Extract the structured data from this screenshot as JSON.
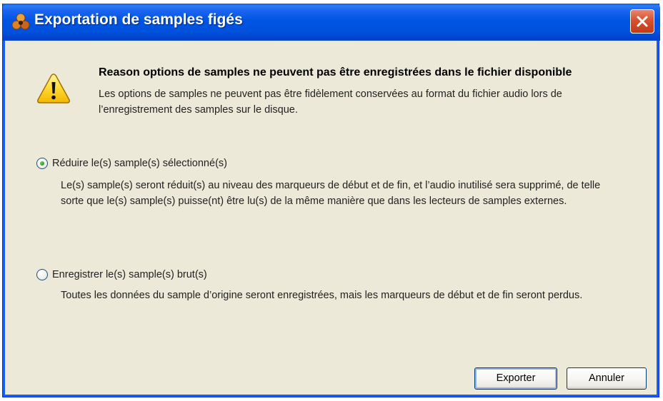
{
  "window": {
    "title": "Exportation de samples figés",
    "icons": {
      "app": "reason-app-icon",
      "close": "close-icon",
      "warning": "warning-icon"
    }
  },
  "message": {
    "headline": "Reason options de samples ne peuvent pas être enregistrées dans le fichier disponible",
    "description": "Les options de samples ne peuvent pas être fidèlement conservées au format du fichier audio lors de l’enregistrement des samples sur le disque."
  },
  "options": [
    {
      "label": "Réduire le(s) sample(s) sélectionné(s)",
      "description": "Le(s) sample(s) seront réduit(s) au niveau des marqueurs de début et de fin, et l’audio inutilisé sera supprimé, de telle sorte que le(s) sample(s) puisse(nt) être lu(s) de la même manière que dans les lecteurs de samples externes.",
      "selected": true
    },
    {
      "label": "Enregistrer le(s) sample(s) brut(s)",
      "description": "Toutes les données du sample d’origine seront enregistrées, mais les marqueurs de début et de fin seront perdus.",
      "selected": false
    }
  ],
  "buttons": {
    "export": "Exporter",
    "cancel": "Annuler"
  },
  "colors": {
    "titlebar": "#0054e3",
    "dialog_bg": "#ece9d8",
    "close_button": "#d6512f",
    "radio_dot": "#2b9a24"
  }
}
